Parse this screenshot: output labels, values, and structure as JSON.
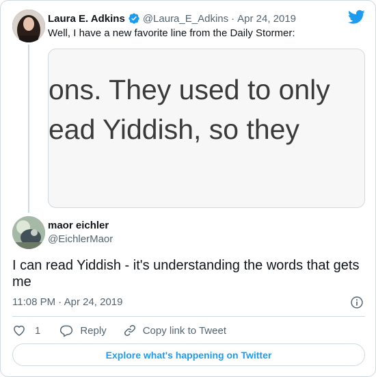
{
  "quoted_tweet": {
    "author_name": "Laura E. Adkins",
    "author_handle": "@Laura_E_Adkins",
    "separator": "·",
    "date": "Apr 24, 2019",
    "text": "Well, I have a new favorite line from the Daily Stormer:",
    "media_text_lines": [
      "ons. They used to only",
      "ead Yiddish, so they"
    ]
  },
  "tweet": {
    "author_name": "maor eichler",
    "author_handle": "@EichlerMaor",
    "text": "I can read Yiddish - it's understanding the words that gets me",
    "timestamp": "11:08 PM · Apr 24, 2019"
  },
  "actions": {
    "like_count": "1",
    "reply_label": "Reply",
    "copy_label": "Copy link to Tweet"
  },
  "explore_label": "Explore what's happening on Twitter",
  "colors": {
    "accent": "#1d9bf0",
    "secondary_text": "#536471",
    "border": "#cfd9de"
  },
  "icons": [
    "verified-badge-icon",
    "twitter-bird-icon",
    "info-icon",
    "heart-icon",
    "reply-icon",
    "link-icon"
  ]
}
